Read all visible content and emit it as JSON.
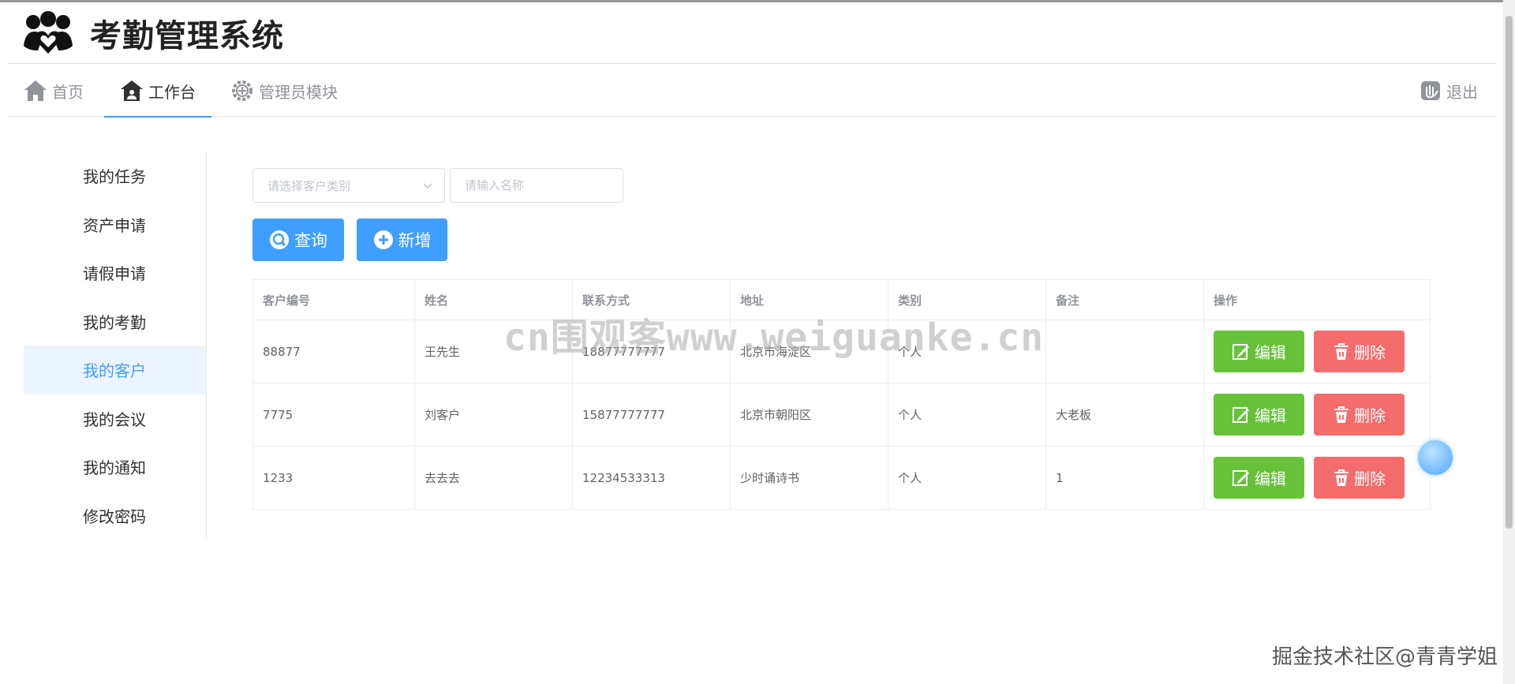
{
  "app": {
    "title": "考勤管理系统"
  },
  "nav": {
    "home": "首页",
    "workbench": "工作台",
    "admin": "管理员模块",
    "logout": "退出"
  },
  "sidebar": {
    "items": [
      {
        "label": "我的任务"
      },
      {
        "label": "资产申请"
      },
      {
        "label": "请假申请"
      },
      {
        "label": "我的考勤"
      },
      {
        "label": "我的客户",
        "active": true
      },
      {
        "label": "我的会议"
      },
      {
        "label": "我的通知"
      },
      {
        "label": "修改密码"
      }
    ]
  },
  "filters": {
    "type_placeholder": "请选择客户类别",
    "name_placeholder": "请输入名称"
  },
  "buttons": {
    "query": "查询",
    "add": "新增"
  },
  "table": {
    "headers": [
      "客户编号",
      "姓名",
      "联系方式",
      "地址",
      "类别",
      "备注",
      "操作"
    ],
    "rows": [
      {
        "id": "88877",
        "name": "王先生",
        "phone": "18877777777",
        "address": "北京市海淀区",
        "type": "个人",
        "note": ""
      },
      {
        "id": "7775",
        "name": "刘客户",
        "phone": "15877777777",
        "address": "北京市朝阳区",
        "type": "个人",
        "note": "大老板"
      },
      {
        "id": "1233",
        "name": "去去去",
        "phone": "12234533313",
        "address": "少时诵诗书",
        "type": "个人",
        "note": "1"
      }
    ],
    "edit_label": "编辑",
    "delete_label": "删除"
  },
  "watermark": "cn围观客www.weiguanke.cn",
  "footer_mark": "掘金技术社区@青青学姐",
  "colors": {
    "primary": "#409eff",
    "success": "#67c23a",
    "danger": "#f56c6c",
    "active_bg": "#ecf5ff"
  }
}
